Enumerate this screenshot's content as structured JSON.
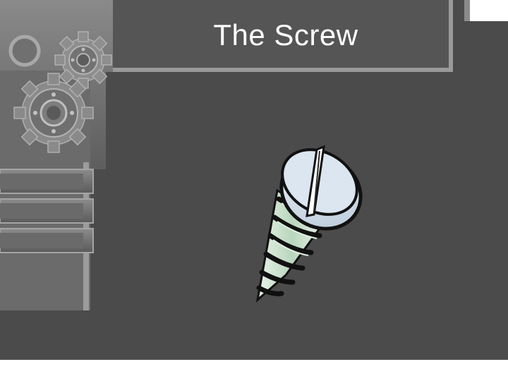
{
  "slide": {
    "title": "The Screw",
    "colors": {
      "background": "#4a4a4a",
      "frame": "#6f6f6f",
      "frame_light": "#9a9a9a",
      "title_text": "#ffffff",
      "bottom_band": "#ffffff"
    }
  },
  "decorations": {
    "gear_icons": [
      "gear-icon",
      "gear-icon"
    ],
    "ring_icon": "ring-icon",
    "screw_clipart": "screw-icon"
  }
}
